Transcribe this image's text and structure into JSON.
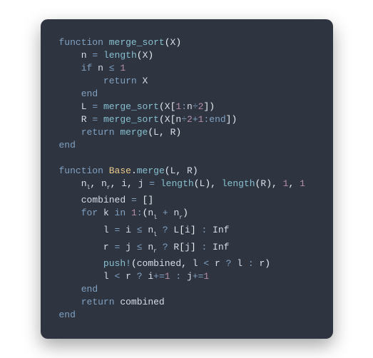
{
  "code": {
    "tokens": [
      [
        {
          "t": "function ",
          "c": "kw"
        },
        {
          "t": "merge_sort",
          "c": "fn"
        },
        {
          "t": "(",
          "c": "punc"
        },
        {
          "t": "X",
          "c": "id"
        },
        {
          "t": ")",
          "c": "punc"
        }
      ],
      [
        {
          "t": "    ",
          "c": "plain"
        },
        {
          "t": "n",
          "c": "id"
        },
        {
          "t": " = ",
          "c": "op"
        },
        {
          "t": "length",
          "c": "fn"
        },
        {
          "t": "(",
          "c": "punc"
        },
        {
          "t": "X",
          "c": "id"
        },
        {
          "t": ")",
          "c": "punc"
        }
      ],
      [
        {
          "t": "    ",
          "c": "plain"
        },
        {
          "t": "if ",
          "c": "kw"
        },
        {
          "t": "n",
          "c": "id"
        },
        {
          "t": " ≤ ",
          "c": "op"
        },
        {
          "t": "1",
          "c": "num"
        }
      ],
      [
        {
          "t": "        ",
          "c": "plain"
        },
        {
          "t": "return ",
          "c": "kw"
        },
        {
          "t": "X",
          "c": "id"
        }
      ],
      [
        {
          "t": "    ",
          "c": "plain"
        },
        {
          "t": "end",
          "c": "kw"
        }
      ],
      [
        {
          "t": "    ",
          "c": "plain"
        },
        {
          "t": "L",
          "c": "id"
        },
        {
          "t": " = ",
          "c": "op"
        },
        {
          "t": "merge_sort",
          "c": "fn"
        },
        {
          "t": "(",
          "c": "punc"
        },
        {
          "t": "X",
          "c": "id"
        },
        {
          "t": "[",
          "c": "punc"
        },
        {
          "t": "1",
          "c": "num"
        },
        {
          "t": ":",
          "c": "op"
        },
        {
          "t": "n",
          "c": "id"
        },
        {
          "t": "÷",
          "c": "op"
        },
        {
          "t": "2",
          "c": "num"
        },
        {
          "t": "]",
          "c": "punc"
        },
        {
          "t": ")",
          "c": "punc"
        }
      ],
      [
        {
          "t": "    ",
          "c": "plain"
        },
        {
          "t": "R",
          "c": "id"
        },
        {
          "t": " = ",
          "c": "op"
        },
        {
          "t": "merge_sort",
          "c": "fn"
        },
        {
          "t": "(",
          "c": "punc"
        },
        {
          "t": "X",
          "c": "id"
        },
        {
          "t": "[",
          "c": "punc"
        },
        {
          "t": "n",
          "c": "id"
        },
        {
          "t": "÷",
          "c": "op"
        },
        {
          "t": "2",
          "c": "num"
        },
        {
          "t": "+",
          "c": "op"
        },
        {
          "t": "1",
          "c": "num"
        },
        {
          "t": ":",
          "c": "op"
        },
        {
          "t": "end",
          "c": "kw"
        },
        {
          "t": "]",
          "c": "punc"
        },
        {
          "t": ")",
          "c": "punc"
        }
      ],
      [
        {
          "t": "    ",
          "c": "plain"
        },
        {
          "t": "return ",
          "c": "kw"
        },
        {
          "t": "merge",
          "c": "fn"
        },
        {
          "t": "(",
          "c": "punc"
        },
        {
          "t": "L",
          "c": "id"
        },
        {
          "t": ",",
          "c": "punc"
        },
        {
          "t": " ",
          "c": "plain"
        },
        {
          "t": "R",
          "c": "id"
        },
        {
          "t": ")",
          "c": "punc"
        }
      ],
      [
        {
          "t": "end",
          "c": "kw"
        }
      ],
      [
        {
          "t": " ",
          "c": "plain"
        }
      ],
      [
        {
          "t": "function ",
          "c": "kw"
        },
        {
          "t": "Base",
          "c": "fn2"
        },
        {
          "t": ".",
          "c": "punc"
        },
        {
          "t": "merge",
          "c": "fn"
        },
        {
          "t": "(",
          "c": "punc"
        },
        {
          "t": "L",
          "c": "id"
        },
        {
          "t": ",",
          "c": "punc"
        },
        {
          "t": " ",
          "c": "plain"
        },
        {
          "t": "R",
          "c": "id"
        },
        {
          "t": ")",
          "c": "punc"
        }
      ],
      [
        {
          "t": "    ",
          "c": "plain"
        },
        {
          "t": "n",
          "c": "id"
        },
        {
          "t": "l",
          "c": "id",
          "sub": true
        },
        {
          "t": ",",
          "c": "punc"
        },
        {
          "t": " ",
          "c": "plain"
        },
        {
          "t": "n",
          "c": "id"
        },
        {
          "t": "r",
          "c": "id",
          "sub": true
        },
        {
          "t": ",",
          "c": "punc"
        },
        {
          "t": " ",
          "c": "plain"
        },
        {
          "t": "i",
          "c": "id"
        },
        {
          "t": ",",
          "c": "punc"
        },
        {
          "t": " ",
          "c": "plain"
        },
        {
          "t": "j",
          "c": "id"
        },
        {
          "t": " = ",
          "c": "op"
        },
        {
          "t": "length",
          "c": "fn"
        },
        {
          "t": "(",
          "c": "punc"
        },
        {
          "t": "L",
          "c": "id"
        },
        {
          "t": ")",
          "c": "punc"
        },
        {
          "t": ",",
          "c": "punc"
        },
        {
          "t": " ",
          "c": "plain"
        },
        {
          "t": "length",
          "c": "fn"
        },
        {
          "t": "(",
          "c": "punc"
        },
        {
          "t": "R",
          "c": "id"
        },
        {
          "t": ")",
          "c": "punc"
        },
        {
          "t": ",",
          "c": "punc"
        },
        {
          "t": " ",
          "c": "plain"
        },
        {
          "t": "1",
          "c": "num"
        },
        {
          "t": ",",
          "c": "punc"
        },
        {
          "t": " ",
          "c": "plain"
        },
        {
          "t": "1",
          "c": "num"
        }
      ],
      [
        {
          "t": "    ",
          "c": "plain"
        },
        {
          "t": "combined",
          "c": "id"
        },
        {
          "t": " = ",
          "c": "op"
        },
        {
          "t": "[]",
          "c": "punc"
        }
      ],
      [
        {
          "t": "    ",
          "c": "plain"
        },
        {
          "t": "for ",
          "c": "kw"
        },
        {
          "t": "k",
          "c": "id"
        },
        {
          "t": " in ",
          "c": "kw"
        },
        {
          "t": "1",
          "c": "num"
        },
        {
          "t": ":",
          "c": "op"
        },
        {
          "t": "(",
          "c": "punc"
        },
        {
          "t": "n",
          "c": "id"
        },
        {
          "t": "l",
          "c": "id",
          "sub": true
        },
        {
          "t": " + ",
          "c": "op"
        },
        {
          "t": "n",
          "c": "id"
        },
        {
          "t": "r",
          "c": "id",
          "sub": true
        },
        {
          "t": ")",
          "c": "punc"
        }
      ],
      [
        {
          "t": "        ",
          "c": "plain"
        },
        {
          "t": "l",
          "c": "id"
        },
        {
          "t": " = ",
          "c": "op"
        },
        {
          "t": "i",
          "c": "id"
        },
        {
          "t": " ≤ ",
          "c": "op"
        },
        {
          "t": "n",
          "c": "id"
        },
        {
          "t": "l",
          "c": "id",
          "sub": true
        },
        {
          "t": " ? ",
          "c": "op"
        },
        {
          "t": "L",
          "c": "id"
        },
        {
          "t": "[",
          "c": "punc"
        },
        {
          "t": "i",
          "c": "id"
        },
        {
          "t": "]",
          "c": "punc"
        },
        {
          "t": " : ",
          "c": "op"
        },
        {
          "t": "Inf",
          "c": "id"
        }
      ],
      [
        {
          "t": "        ",
          "c": "plain"
        },
        {
          "t": "r",
          "c": "id"
        },
        {
          "t": " = ",
          "c": "op"
        },
        {
          "t": "j",
          "c": "id"
        },
        {
          "t": " ≤ ",
          "c": "op"
        },
        {
          "t": "n",
          "c": "id"
        },
        {
          "t": "r",
          "c": "id",
          "sub": true
        },
        {
          "t": " ? ",
          "c": "op"
        },
        {
          "t": "R",
          "c": "id"
        },
        {
          "t": "[",
          "c": "punc"
        },
        {
          "t": "j",
          "c": "id"
        },
        {
          "t": "]",
          "c": "punc"
        },
        {
          "t": " : ",
          "c": "op"
        },
        {
          "t": "Inf",
          "c": "id"
        }
      ],
      [
        {
          "t": "        ",
          "c": "plain"
        },
        {
          "t": "push!",
          "c": "fn"
        },
        {
          "t": "(",
          "c": "punc"
        },
        {
          "t": "combined",
          "c": "id"
        },
        {
          "t": ",",
          "c": "punc"
        },
        {
          "t": " ",
          "c": "plain"
        },
        {
          "t": "l",
          "c": "id"
        },
        {
          "t": " < ",
          "c": "op"
        },
        {
          "t": "r",
          "c": "id"
        },
        {
          "t": " ? ",
          "c": "op"
        },
        {
          "t": "l",
          "c": "id"
        },
        {
          "t": " : ",
          "c": "op"
        },
        {
          "t": "r",
          "c": "id"
        },
        {
          "t": ")",
          "c": "punc"
        }
      ],
      [
        {
          "t": "        ",
          "c": "plain"
        },
        {
          "t": "l",
          "c": "id"
        },
        {
          "t": " < ",
          "c": "op"
        },
        {
          "t": "r",
          "c": "id"
        },
        {
          "t": " ? ",
          "c": "op"
        },
        {
          "t": "i",
          "c": "id"
        },
        {
          "t": "+=",
          "c": "op"
        },
        {
          "t": "1",
          "c": "num"
        },
        {
          "t": " : ",
          "c": "op"
        },
        {
          "t": "j",
          "c": "id"
        },
        {
          "t": "+=",
          "c": "op"
        },
        {
          "t": "1",
          "c": "num"
        }
      ],
      [
        {
          "t": "    ",
          "c": "plain"
        },
        {
          "t": "end",
          "c": "kw"
        }
      ],
      [
        {
          "t": "    ",
          "c": "plain"
        },
        {
          "t": "return ",
          "c": "kw"
        },
        {
          "t": "combined",
          "c": "id"
        }
      ],
      [
        {
          "t": "end",
          "c": "kw"
        }
      ]
    ]
  }
}
